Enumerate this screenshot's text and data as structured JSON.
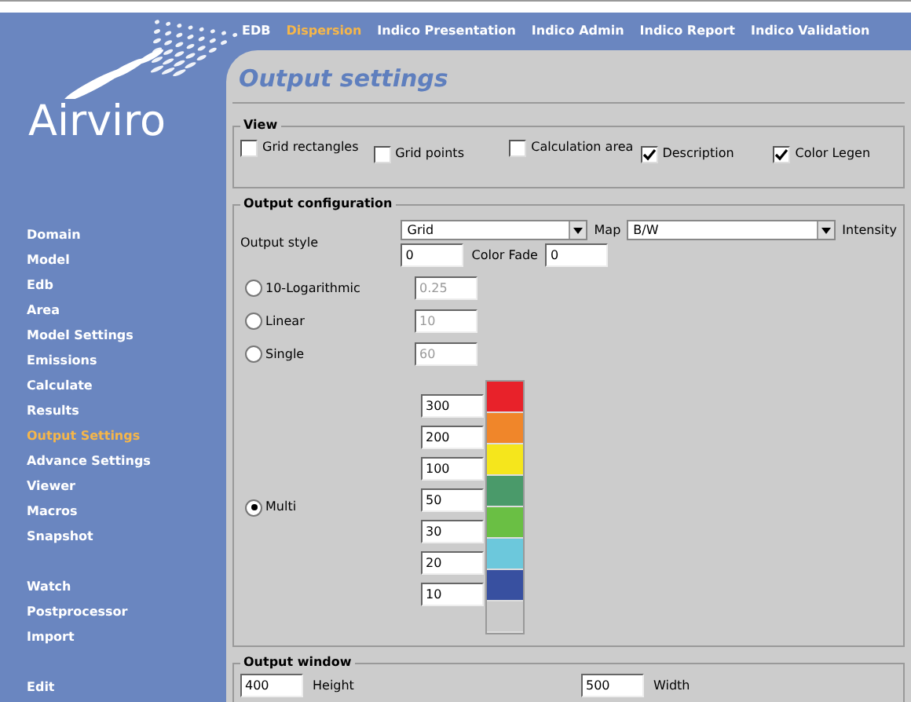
{
  "brand": "Airviro",
  "tabs": [
    {
      "label": "EDB",
      "selected": false
    },
    {
      "label": "Dispersion",
      "selected": true
    },
    {
      "label": "Indico Presentation",
      "selected": false
    },
    {
      "label": "Indico Admin",
      "selected": false
    },
    {
      "label": "Indico Report",
      "selected": false
    },
    {
      "label": "Indico Validation",
      "selected": false
    }
  ],
  "sidebar": {
    "groups": [
      [
        {
          "label": "Domain",
          "selected": false
        },
        {
          "label": "Model",
          "selected": false
        },
        {
          "label": "Edb",
          "selected": false
        },
        {
          "label": "Area",
          "selected": false
        },
        {
          "label": "Model Settings",
          "selected": false
        },
        {
          "label": "Emissions",
          "selected": false
        },
        {
          "label": "Calculate",
          "selected": false
        },
        {
          "label": "Results",
          "selected": false
        },
        {
          "label": "Output Settings",
          "selected": true
        },
        {
          "label": "Advance Settings",
          "selected": false
        },
        {
          "label": "Viewer",
          "selected": false
        },
        {
          "label": "Macros",
          "selected": false
        },
        {
          "label": "Snapshot",
          "selected": false
        }
      ],
      [
        {
          "label": "Watch",
          "selected": false
        },
        {
          "label": "Postprocessor",
          "selected": false
        },
        {
          "label": "Import",
          "selected": false
        }
      ],
      [
        {
          "label": "Edit",
          "selected": false
        }
      ]
    ]
  },
  "page_title": "Output settings",
  "view": {
    "legend": "View",
    "options": [
      {
        "label": "Grid rectangles",
        "checked": false
      },
      {
        "label": "Grid points",
        "checked": false
      },
      {
        "label": "Calculation area",
        "checked": false
      },
      {
        "label": "Description",
        "checked": true
      },
      {
        "label": "Color Legen",
        "checked": true
      }
    ]
  },
  "output_configuration": {
    "legend": "Output configuration",
    "output_style": {
      "label": "Output style",
      "value": "Grid"
    },
    "map": {
      "label": "Map",
      "value": "B/W"
    },
    "intensity": {
      "label": "Intensity"
    },
    "first_value": "0",
    "color_fade": {
      "label": "Color Fade",
      "value": "0"
    },
    "scales": [
      {
        "label": "10-Logarithmic",
        "value": "0.25",
        "selected": false
      },
      {
        "label": "Linear",
        "value": "10",
        "selected": false
      },
      {
        "label": "Single",
        "value": "60",
        "selected": false
      }
    ],
    "multi": {
      "label": "Multi",
      "selected": true,
      "values": [
        "300",
        "200",
        "100",
        "50",
        "30",
        "20",
        "10"
      ],
      "swatches": [
        {
          "color": "#e8222a"
        },
        {
          "color": "#f0862a"
        },
        {
          "color": "#f5e61c"
        },
        {
          "color": "#4a9a6a"
        },
        {
          "color": "#6abf44"
        },
        {
          "color": "#6cc8dc"
        },
        {
          "color": "#3850a0"
        },
        {
          "color": "#cbcbcb"
        }
      ]
    }
  },
  "output_window": {
    "legend": "Output window",
    "height": {
      "value": "400",
      "label": "Height"
    },
    "width": {
      "value": "500",
      "label": "Width"
    }
  }
}
